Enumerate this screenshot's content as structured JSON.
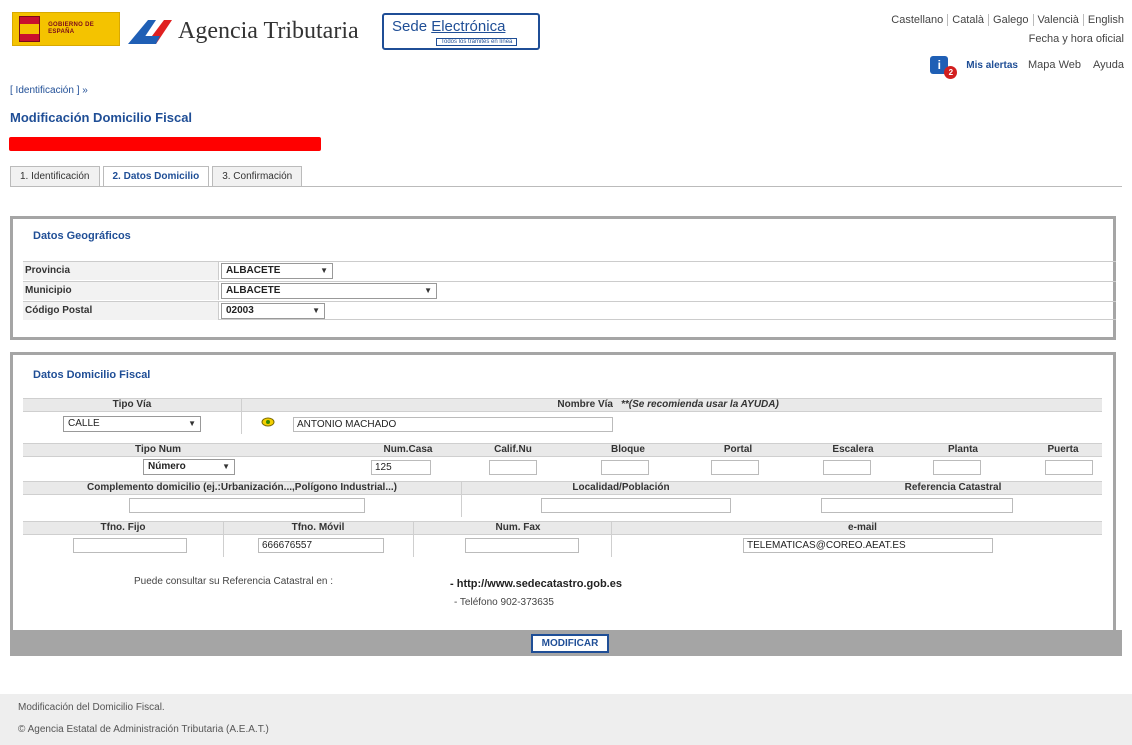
{
  "header": {
    "gov_logo_text": "GOBIERNO DE ESPAÑA",
    "agency_name": "Agencia Tributaria",
    "sede_title_prefix": "Sede",
    "sede_title_link": "Electrónica",
    "sede_subtitle": "Todos los trámites en línea",
    "languages": [
      "Castellano",
      "Català",
      "Galego",
      "Valencià",
      "English"
    ],
    "fecha_hora": "Fecha y hora oficial",
    "alert_count": "2",
    "mis_alertas": "Mis alertas",
    "mapa_web": "Mapa Web",
    "ayuda": "Ayuda"
  },
  "breadcrumb": "[ Identificación ] »",
  "page_title": "Modificación Domicilio Fiscal",
  "tabs": [
    {
      "label": "1. Identificación",
      "active": false
    },
    {
      "label": "2. Datos Domicilio",
      "active": true
    },
    {
      "label": "3. Confirmación",
      "active": false
    }
  ],
  "geo": {
    "title": "Datos Geográficos",
    "provincia_label": "Provincia",
    "provincia_value": "ALBACETE",
    "municipio_label": "Municipio",
    "municipio_value": "ALBACETE",
    "cp_label": "Código Postal",
    "cp_value": "02003"
  },
  "domicilio": {
    "title": "Datos Domicilio Fiscal",
    "tipo_via_label": "Tipo Vía",
    "tipo_via_value": "CALLE",
    "nombre_via_label": "Nombre Vía",
    "nombre_via_note": "**(Se recomienda usar la AYUDA)",
    "nombre_via_value": "ANTONIO MACHADO",
    "tipo_num_label": "Tipo Num",
    "tipo_num_value": "Número",
    "num_casa_label": "Num.Casa",
    "num_casa_value": "125",
    "calif_label": "Calif.Nu",
    "bloque_label": "Bloque",
    "portal_label": "Portal",
    "escalera_label": "Escalera",
    "planta_label": "Planta",
    "puerta_label": "Puerta",
    "complemento_label": "Complemento domicilio (ej.:Urbanización...,Polígono Industrial...)",
    "localidad_label": "Localidad/Población",
    "ref_catastral_label": "Referencia Catastral",
    "tfno_fijo_label": "Tfno. Fijo",
    "tfno_movil_label": "Tfno. Móvil",
    "tfno_movil_value": "666676557",
    "num_fax_label": "Num. Fax",
    "email_label": "e-mail",
    "email_value": "TELEMATICAS@COREO.AEAT.ES"
  },
  "consulta": {
    "text": "Puede consultar su Referencia Catastral en :",
    "link": "- http://www.sedecatastro.gob.es",
    "telefono": "- Teléfono 902-373635"
  },
  "button_modificar": "MODIFICAR",
  "footer": {
    "line1": "Modificación del Domicilio Fiscal.",
    "line2": "© Agencia Estatal de Administración Tributaria (A.E.A.T.)"
  },
  "colors": {
    "brand_blue": "#1f4e96",
    "alert_red": "#d21f1f",
    "redacted_bar": "#ff0000"
  }
}
